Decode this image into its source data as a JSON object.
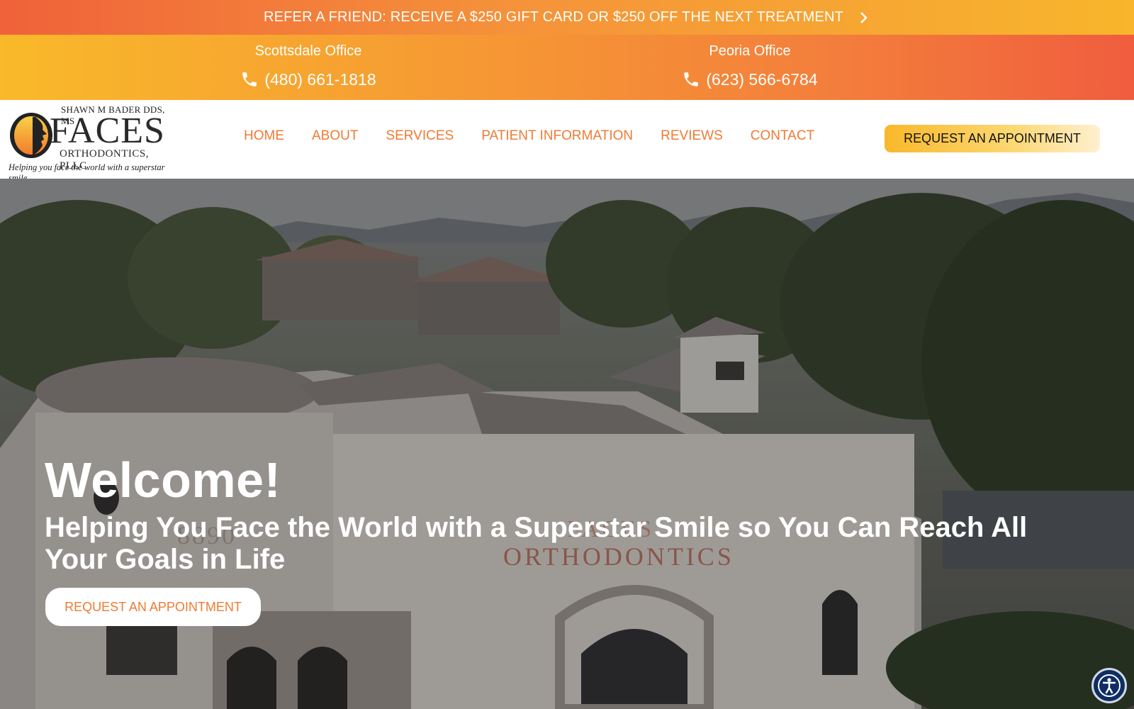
{
  "promo": {
    "text": "REFER A FRIEND: RECEIVE A $250 GIFT CARD OR $250 OFF THE NEXT TREATMENT",
    "icon": "chevron-right-icon"
  },
  "offices": [
    {
      "name": "Scottsdale Office",
      "phone": "(480) 661-1818"
    },
    {
      "name": "Peoria Office",
      "phone": "(623) 566-6784"
    }
  ],
  "logo": {
    "top_line": "SHAWN M BADER DDS, MS",
    "word": "FACES",
    "sub_line": "ORTHODONTICS, PLLC",
    "tagline": "Helping you face the world with a superstar smile"
  },
  "nav": {
    "items": [
      "HOME",
      "ABOUT",
      "SERVICES",
      "PATIENT INFORMATION",
      "REVIEWS",
      "CONTACT"
    ],
    "cta": "REQUEST AN APPOINTMENT"
  },
  "hero": {
    "title": "Welcome!",
    "subtitle": "Helping You Face the World with a Superstar Smile so You Can Reach All Your Goals in Life",
    "cta": "REQUEST AN APPOINTMENT"
  },
  "colors": {
    "accent_orange": "#f07a32",
    "accent_yellow": "#f9b82a",
    "accessibility_blue": "#0f2d63"
  },
  "accessibility": {
    "icon": "accessibility-icon"
  }
}
